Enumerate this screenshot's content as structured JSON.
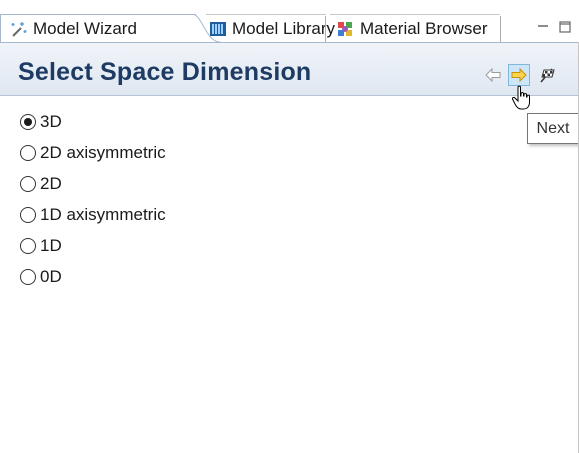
{
  "tabs": [
    {
      "label": "Model Wizard",
      "icon": "wand-icon",
      "active": true
    },
    {
      "label": "Model Library",
      "icon": "library-icon",
      "active": false
    },
    {
      "label": "Material Browser",
      "icon": "material-icon",
      "active": false
    }
  ],
  "header": {
    "title": "Select Space Dimension"
  },
  "tooltip": {
    "text": "Next"
  },
  "options": [
    {
      "label": "3D",
      "selected": true
    },
    {
      "label": "2D axisymmetric",
      "selected": false
    },
    {
      "label": "2D",
      "selected": false
    },
    {
      "label": "1D axisymmetric",
      "selected": false
    },
    {
      "label": "1D",
      "selected": false
    },
    {
      "label": "0D",
      "selected": false
    }
  ],
  "colors": {
    "title": "#1d3b63",
    "header_bg": "#e6edf5",
    "next_highlight": "#cde6f7"
  }
}
